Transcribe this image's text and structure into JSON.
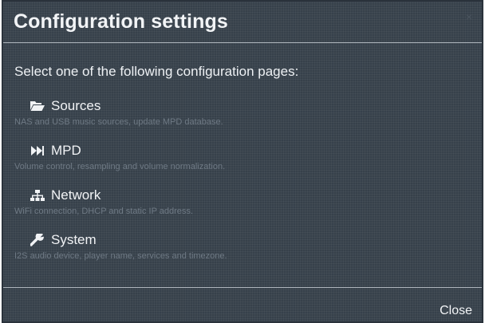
{
  "header": {
    "title": "Configuration settings",
    "close_glyph": "×"
  },
  "intro": "Select one of the following configuration pages:",
  "pages": [
    {
      "title": "Sources",
      "description": "NAS and USB music sources, update MPD database.",
      "icon": "folder-open-icon"
    },
    {
      "title": "MPD",
      "description": "Volume control, resampling and volume normalization.",
      "icon": "fast-forward-icon"
    },
    {
      "title": "Network",
      "description": "WiFi connection, DHCP and static IP address.",
      "icon": "sitemap-icon"
    },
    {
      "title": "System",
      "description": "I2S audio device, player name, services and timezone.",
      "icon": "wrench-icon"
    }
  ],
  "footer": {
    "close_label": "Close"
  },
  "colors": {
    "background": "#37414b",
    "title_text": "#f2f4f6",
    "description_text": "#6f7a85",
    "divider": "#aeb5bc"
  }
}
